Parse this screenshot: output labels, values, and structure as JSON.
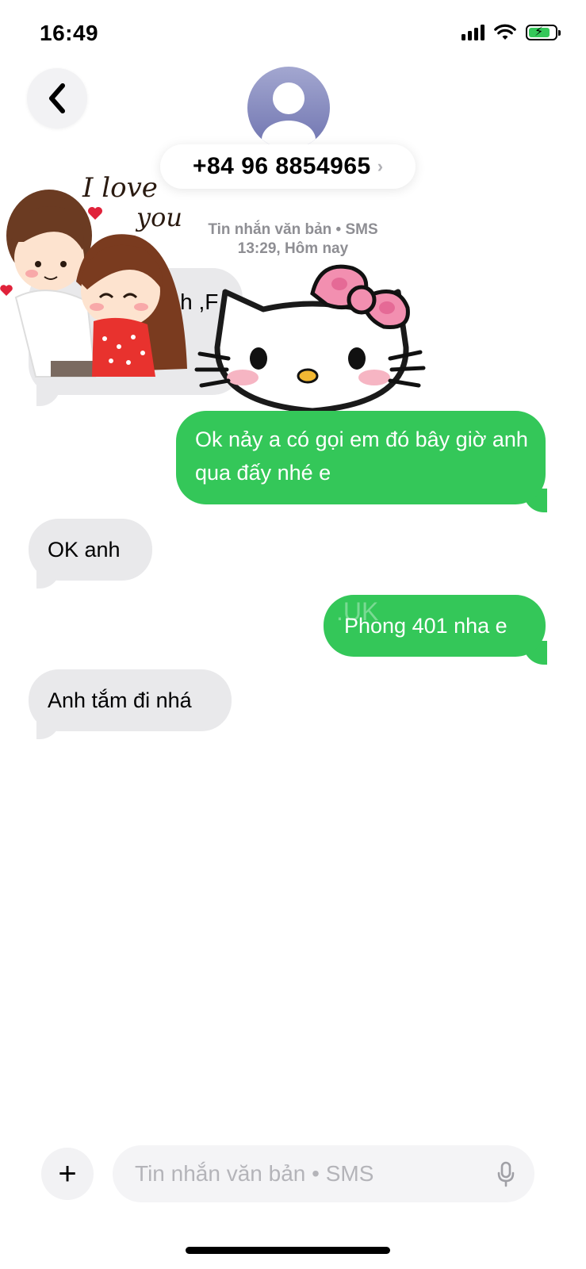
{
  "status_bar": {
    "time": "16:49",
    "signal_icon": "cellular-signal-icon",
    "wifi_icon": "wifi-icon",
    "battery_icon": "battery-charging-icon",
    "battery_color": "#34c759"
  },
  "header": {
    "back_icon": "chevron-left-icon",
    "contact_name": "+84 96 8854965",
    "chevron": "›"
  },
  "thread_meta": {
    "line1": "Tin nhắn văn bản • SMS",
    "line2": "13:29, Hôm nay"
  },
  "stickers": {
    "couple_text_line1": "I love",
    "couple_text_line2": "you",
    "cat_sticker": "hello-kitty-sticker"
  },
  "messages": [
    {
      "direction": "incoming",
      "text": "anh ,F ac",
      "partially_hidden": true
    },
    {
      "direction": "outgoing",
      "text": "Ok nảy a có gọi em đó bây giờ anh qua đấy nhé e"
    },
    {
      "direction": "incoming",
      "text": "OK anh"
    },
    {
      "direction": "outgoing",
      "text": "Phong 401 nha e",
      "watermark": ".UK"
    },
    {
      "direction": "incoming",
      "text": "Anh tắm đi nhá"
    }
  ],
  "colors": {
    "outgoing_bubble": "#34c759",
    "incoming_bubble": "#e9e9eb",
    "meta_text": "#8e8e93"
  },
  "composer": {
    "plus_label": "+",
    "placeholder": "Tin nhắn văn bản • SMS",
    "mic_icon": "microphone-icon"
  }
}
